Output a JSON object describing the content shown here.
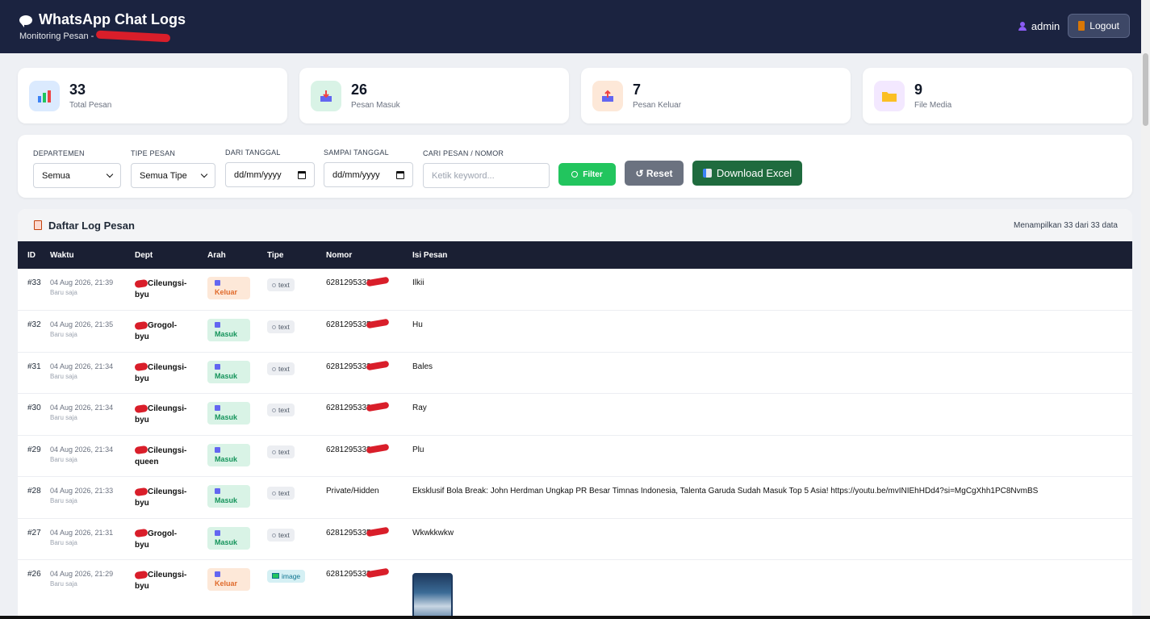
{
  "header": {
    "title": "WhatsApp Chat Logs",
    "subtitle": "Monitoring Pesan -",
    "username": "admin",
    "logout_label": "Logout"
  },
  "stats": [
    {
      "value": "33",
      "label": "Total Pesan",
      "icon": "bar-chart-icon"
    },
    {
      "value": "26",
      "label": "Pesan Masuk",
      "icon": "inbox-icon"
    },
    {
      "value": "7",
      "label": "Pesan Keluar",
      "icon": "outbox-icon"
    },
    {
      "value": "9",
      "label": "File Media",
      "icon": "folder-icon"
    }
  ],
  "filters": {
    "departemen_label": "DEPARTEMEN",
    "departemen_value": "Semua",
    "tipe_label": "TIPE PESAN",
    "tipe_value": "Semua Tipe",
    "dari_label": "DARI TANGGAL",
    "dari_placeholder": "dd/mm/yyyy",
    "sampai_label": "SAMPAI TANGGAL",
    "sampai_placeholder": "dd/mm/yyyy",
    "cari_label": "CARI PESAN / NOMOR",
    "cari_placeholder": "Ketik keyword...",
    "filter_label": "Filter",
    "reset_label": "↺ Reset",
    "excel_label": "Download Excel"
  },
  "log": {
    "title": "Daftar Log Pesan",
    "count_text": "Menampilkan 33 dari 33 data",
    "columns": [
      "ID",
      "Waktu",
      "Dept",
      "Arah",
      "Tipe",
      "Nomor",
      "Isi Pesan"
    ],
    "rows": [
      {
        "id": "#33",
        "time": "04 Aug 2026, 21:39",
        "ago": "Baru saja",
        "dept1": "Cileungsi-",
        "dept2": "byu",
        "arah": "Keluar",
        "tipe": "text",
        "nomor": "6281295332",
        "isi": "Ilkii"
      },
      {
        "id": "#32",
        "time": "04 Aug 2026, 21:35",
        "ago": "Baru saja",
        "dept1": "Grogol-",
        "dept2": "byu",
        "arah": "Masuk",
        "tipe": "text",
        "nomor": "6281295335",
        "isi": "Hu"
      },
      {
        "id": "#31",
        "time": "04 Aug 2026, 21:34",
        "ago": "Baru saja",
        "dept1": "Cileungsi-",
        "dept2": "byu",
        "arah": "Masuk",
        "tipe": "text",
        "nomor": "6281295332",
        "isi": "Bales"
      },
      {
        "id": "#30",
        "time": "04 Aug 2026, 21:34",
        "ago": "Baru saja",
        "dept1": "Cileungsi-",
        "dept2": "byu",
        "arah": "Masuk",
        "tipe": "text",
        "nomor": "6281295332",
        "isi": "Ray"
      },
      {
        "id": "#29",
        "time": "04 Aug 2026, 21:34",
        "ago": "Baru saja",
        "dept1": "Cileungsi-",
        "dept2": "queen",
        "arah": "Masuk",
        "tipe": "text",
        "nomor": "6281295332",
        "isi": "Plu"
      },
      {
        "id": "#28",
        "time": "04 Aug 2026, 21:33",
        "ago": "Baru saja",
        "dept1": "Cileungsi-",
        "dept2": "byu",
        "arah": "Masuk",
        "tipe": "text",
        "nomor": "Private/Hidden",
        "isi": "Eksklusif Bola Break: John Herdman Ungkap PR Besar Timnas Indonesia, Talenta Garuda Sudah Masuk Top 5 Asia! https://youtu.be/mvINIEhHDd4?si=MgCgXhh1PC8NvmBS"
      },
      {
        "id": "#27",
        "time": "04 Aug 2026, 21:31",
        "ago": "Baru saja",
        "dept1": "Grogol-",
        "dept2": "byu",
        "arah": "Masuk",
        "tipe": "text",
        "nomor": "6281295335",
        "isi": "Wkwkkwkw"
      },
      {
        "id": "#26",
        "time": "04 Aug 2026, 21:29",
        "ago": "Baru saja",
        "dept1": "Cileungsi-",
        "dept2": "byu",
        "arah": "Keluar",
        "tipe": "image",
        "nomor": "6281295332",
        "isi": ""
      }
    ]
  },
  "colors": {
    "header_bg": "#1b2340",
    "table_head_bg": "#1a1f33",
    "masuk": "#15945b",
    "keluar": "#e06b2c",
    "filter_green": "#22c55e",
    "excel_green": "#1f6b3e",
    "redaction": "#d91e2a"
  }
}
